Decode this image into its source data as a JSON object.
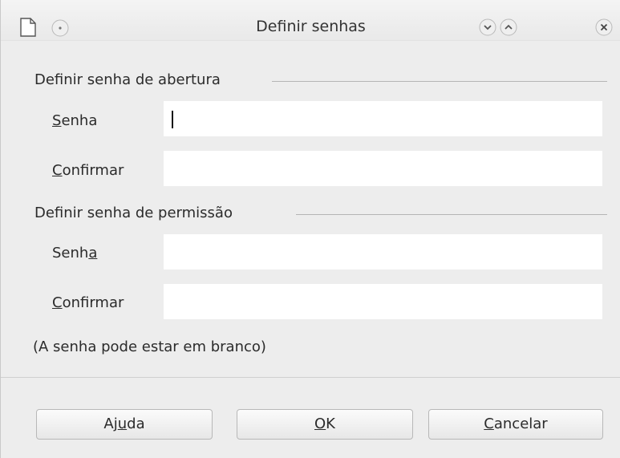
{
  "window": {
    "title": "Definir senhas"
  },
  "opening": {
    "section_title": "Definir senha de abertura",
    "password_label_pre": "",
    "password_label_key": "S",
    "password_label_post": "enha",
    "confirm_label_key": "C",
    "confirm_label_post": "onfirmar",
    "password_value": "",
    "confirm_value": ""
  },
  "permission": {
    "section_title": "Definir senha de permissão",
    "password_label_pre": "Senh",
    "password_label_key": "a",
    "confirm_label_key": "C",
    "confirm_label_post": "onfirmar",
    "password_value": "",
    "confirm_value": ""
  },
  "hint": "(A senha pode estar em branco)",
  "buttons": {
    "help_pre": "Aj",
    "help_key": "u",
    "help_post": "da",
    "ok_key": "O",
    "ok_post": "K",
    "cancel_key": "C",
    "cancel_post": "ancelar"
  },
  "colors": {
    "background": "#ededed",
    "input_background": "#ffffff",
    "button_border": "#b8b8b8"
  },
  "icons": {
    "document": "document-icon",
    "window_menu": "window-menu-icon",
    "minimize": "chevron-down-icon",
    "maximize": "chevron-up-icon",
    "close": "close-icon"
  }
}
